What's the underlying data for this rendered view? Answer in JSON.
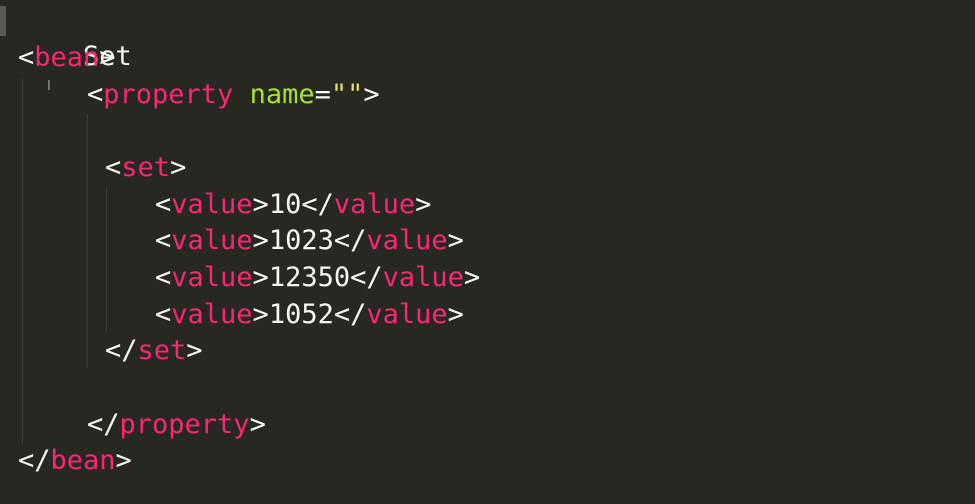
{
  "editor": {
    "heading": "Set",
    "lines": {
      "bean_open": {
        "open": "<",
        "tag": "bean",
        "close": ">"
      },
      "property_open": {
        "open": "<",
        "tag": "property",
        "space": " ",
        "attr": "name",
        "eq": "=",
        "str": "\"\"",
        "close": ">"
      },
      "set_open": {
        "open": "<",
        "tag": "set",
        "close": ">"
      },
      "values": [
        {
          "open": "<",
          "tag": "value",
          "close": ">",
          "text": "10",
          "end_open": "</",
          "end_tag": "value",
          "end_close": ">"
        },
        {
          "open": "<",
          "tag": "value",
          "close": ">",
          "text": "1023",
          "end_open": "</",
          "end_tag": "value",
          "end_close": ">"
        },
        {
          "open": "<",
          "tag": "value",
          "close": ">",
          "text": "12350",
          "end_open": "</",
          "end_tag": "value",
          "end_close": ">"
        },
        {
          "open": "<",
          "tag": "value",
          "close": ">",
          "text": "1052",
          "end_open": "</",
          "end_tag": "value",
          "end_close": ">"
        }
      ],
      "set_close": {
        "open": "</",
        "tag": "set",
        "close": ">"
      },
      "property_close": {
        "open": "</",
        "tag": "property",
        "close": ">"
      },
      "bean_close": {
        "open": "</",
        "tag": "bean",
        "close": ">"
      }
    },
    "cursor_glyph": "I"
  },
  "colors": {
    "background": "#272822",
    "tag": "#f92672",
    "attribute": "#a6e22e",
    "string": "#e6db74",
    "text": "#f8f8f2"
  }
}
